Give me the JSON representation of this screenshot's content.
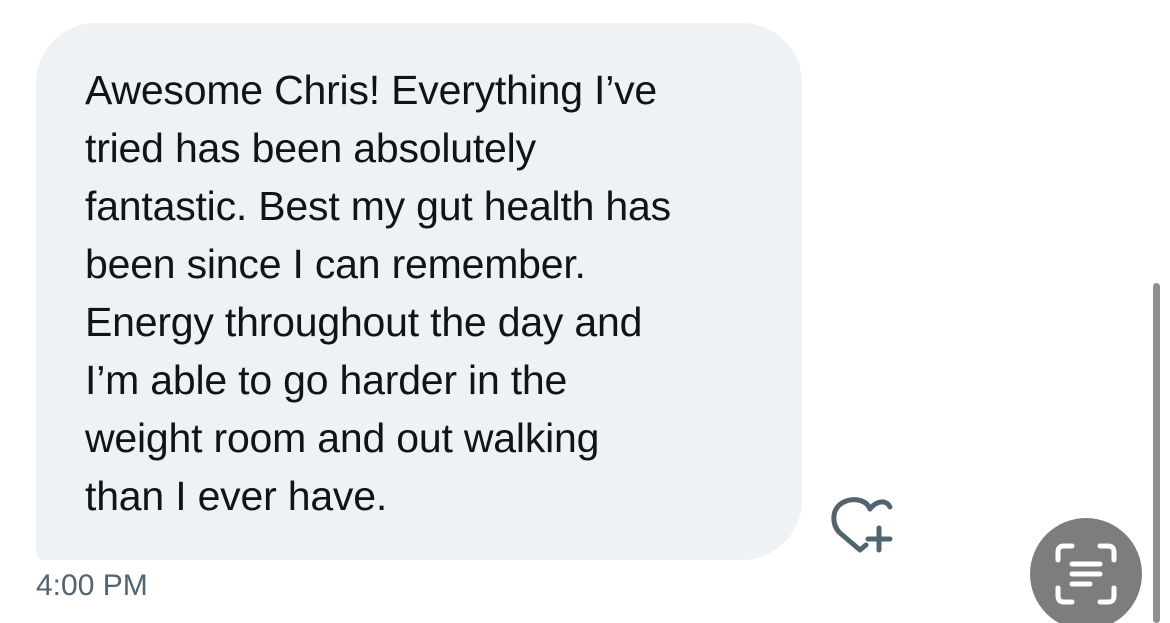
{
  "message": {
    "lines": [
      "Awesome Chris! Everything I’ve",
      "tried has been absolutely",
      "fantastic. Best my gut health has",
      "been since I can remember.",
      "Energy throughout the day and",
      "I’m able to go harder in the",
      "weight room and out walking",
      "than I ever have."
    ],
    "timestamp": "4:00 PM"
  },
  "icons": {
    "react": "heart-plus-icon",
    "live_text": "text-scan-icon"
  },
  "colors": {
    "bubble": "#eff2f4",
    "text": "#0f1419",
    "timestamp": "#536471",
    "icon": "#536471",
    "scan_button": "#7d7d80"
  }
}
